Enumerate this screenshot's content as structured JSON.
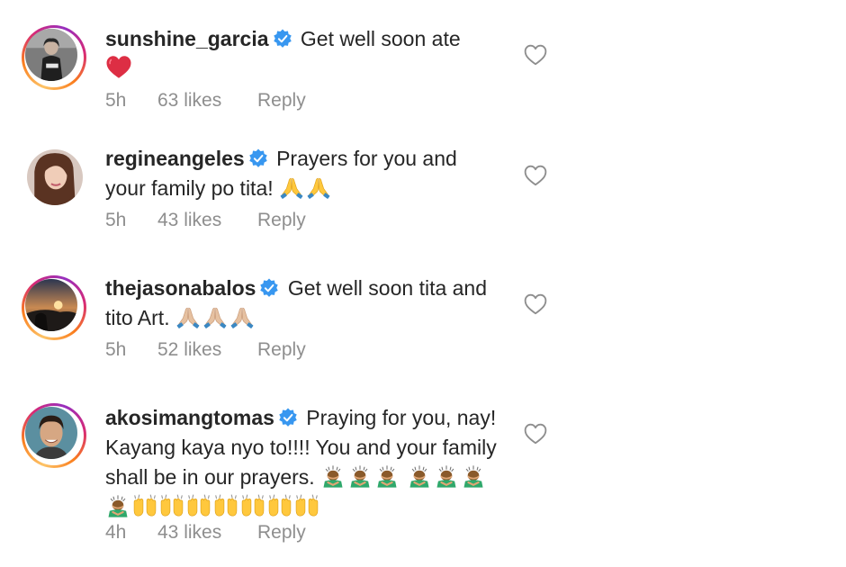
{
  "comments": [
    {
      "username": "sunshine_garcia",
      "text": "Get well soon ate",
      "time": "5h",
      "likes": "63 likes",
      "reply": "Reply",
      "emoji": [
        "red-heart"
      ]
    },
    {
      "username": "regineangeles",
      "text": "Prayers for you and your family po tita!",
      "time": "5h",
      "likes": "43 likes",
      "reply": "Reply",
      "emoji": [
        "folded-hands",
        "folded-hands"
      ]
    },
    {
      "username": "thejasonabalos",
      "text": "Get well soon tita and tito Art.",
      "time": "5h",
      "likes": "52 likes",
      "reply": "Reply",
      "emoji": [
        "folded-hands-light",
        "folded-hands-light",
        "folded-hands-light"
      ]
    },
    {
      "username": "akosimangtomas",
      "text": "Praying for you, nay! Kayang kaya nyo to!!!! You and your family shall be in our prayers.",
      "time": "4h",
      "likes": "43 likes",
      "reply": "Reply",
      "emoji": [
        "person-bowing",
        "person-bowing",
        "person-bowing",
        "person-bowing",
        "person-bowing",
        "person-bowing",
        "person-bowing",
        "raising-hands",
        "raising-hands",
        "raising-hands",
        "raising-hands",
        "raising-hands",
        "raising-hands",
        "raising-hands"
      ]
    }
  ],
  "icons": {
    "verified": "verified-badge-icon",
    "like": "heart-outline-icon"
  },
  "colors": {
    "verified": "#3897f0",
    "meta_text": "#8e8e8e",
    "text": "#262626"
  }
}
